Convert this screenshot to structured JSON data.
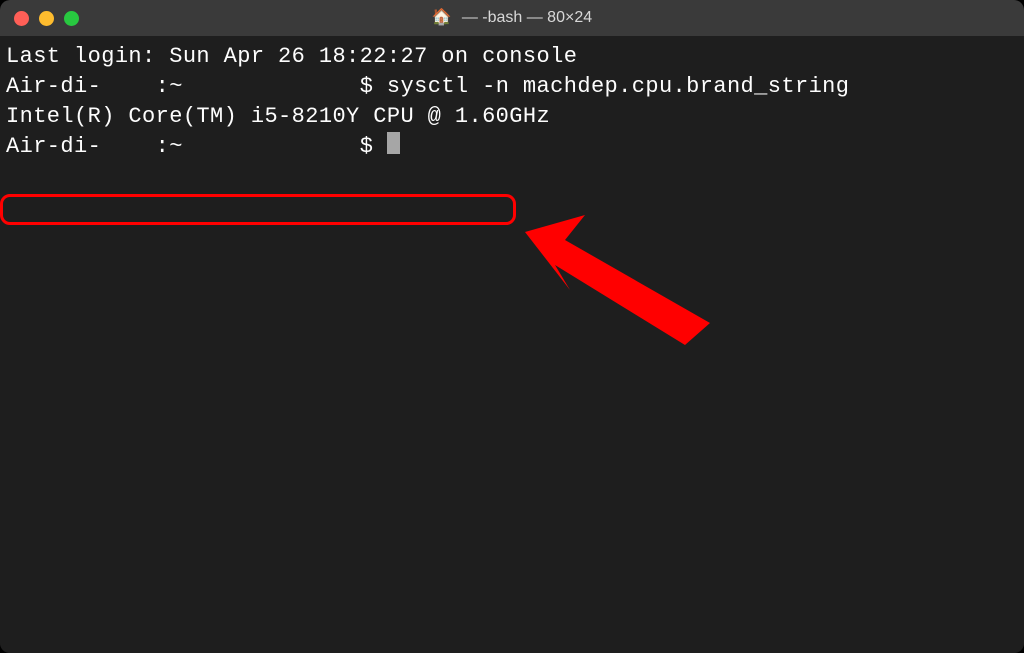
{
  "window": {
    "title_text": "— -bash — 80×24",
    "folder_emoji": "🏠"
  },
  "terminal": {
    "last_login": "Last login: Sun Apr 26 18:22:27 on console",
    "blank1": "",
    "blank2": "",
    "blank3": "",
    "line1_host": "Air-di-",
    "line1_path": ":~",
    "line1_prompt": "$",
    "line1_cmd": "sysctl -n machdep.cpu.brand_string",
    "output": "Intel(R) Core(TM) i5-8210Y CPU @ 1.60GHz",
    "line2_host": "Air-di-",
    "line2_path": ":~",
    "line2_prompt": "$"
  },
  "annotation": {
    "highlight_color": "#ff0000",
    "arrow_color": "#ff0000"
  }
}
